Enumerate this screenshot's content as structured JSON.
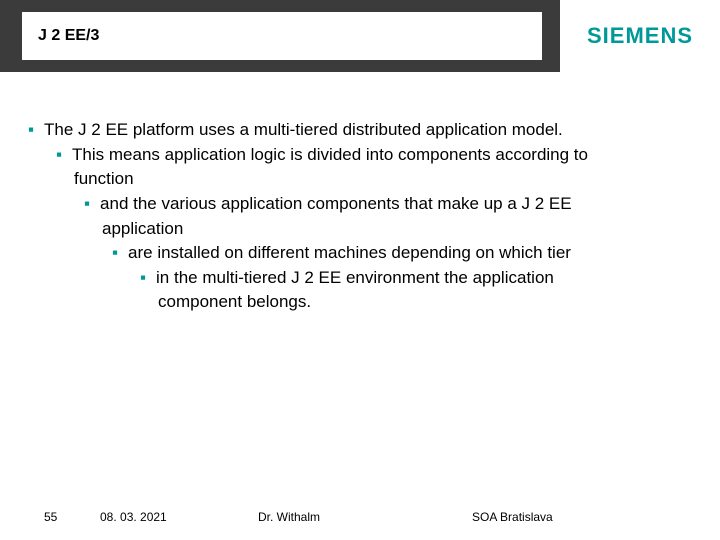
{
  "header": {
    "title": "J 2 EE/3",
    "logo": "SIEMENS"
  },
  "bullets": {
    "l0": "The J 2 EE platform uses a multi-tiered distributed application model.",
    "l1": "This means application logic is divided into components according to",
    "l1c": "function",
    "l2": "and the various application components that make up a J 2 EE",
    "l2c": "application",
    "l3": "are installed on different machines depending on which tier",
    "l4": " in the multi-tiered J 2 EE environment the application",
    "l4c": "component belongs."
  },
  "footer": {
    "page": "55",
    "date": "08. 03. 2021",
    "author": "Dr. Withalm",
    "event": "SOA Bratislava"
  }
}
